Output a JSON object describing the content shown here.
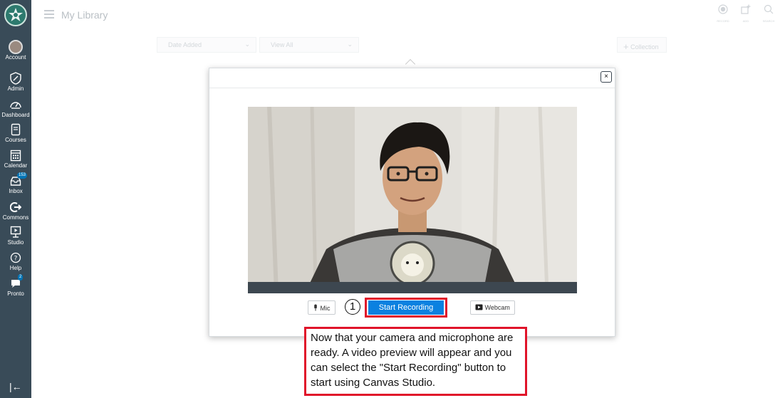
{
  "nav": {
    "items": [
      {
        "label": "Account"
      },
      {
        "label": "Admin"
      },
      {
        "label": "Dashboard"
      },
      {
        "label": "Courses"
      },
      {
        "label": "Calendar"
      },
      {
        "label": "Inbox",
        "badge": "153"
      },
      {
        "label": "Commons"
      },
      {
        "label": "Studio"
      },
      {
        "label": "Help"
      },
      {
        "label": "Pronto",
        "badge": "2"
      }
    ]
  },
  "header": {
    "title": "My Library",
    "tools": [
      {
        "label": "RECORD",
        "icon": "record-icon"
      },
      {
        "label": "ADD",
        "icon": "add-media-icon"
      },
      {
        "label": "SEARCH",
        "icon": "search-icon"
      }
    ]
  },
  "toolbar": {
    "sort": "Date Added",
    "filter": "View All",
    "collection_button": "Collection"
  },
  "modal": {
    "close_label": "×",
    "mic_label": "Mic",
    "start_label": "Start Recording",
    "webcam_label": "Webcam",
    "step_number": "1"
  },
  "callout": {
    "text": "Now that your camera and microphone are ready. A video preview will appear and you can select the \"Start Recording\" button to start using Canvas Studio."
  },
  "colors": {
    "nav_bg": "#394b58",
    "accent_blue": "#0b81e0",
    "highlight_red": "#e0142a"
  }
}
